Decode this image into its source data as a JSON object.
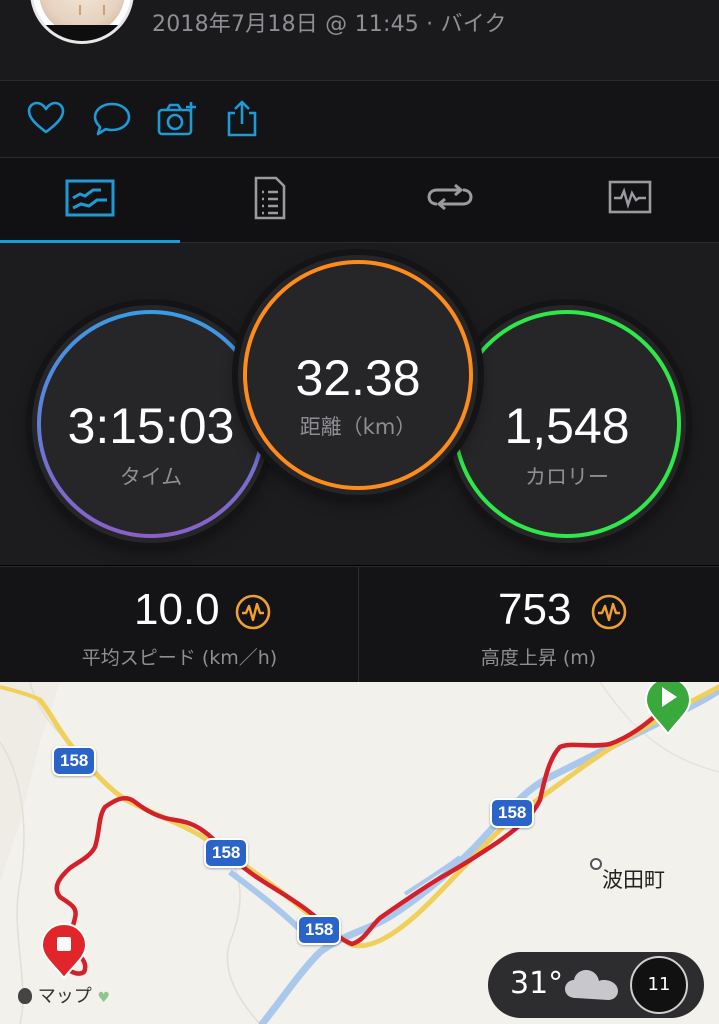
{
  "header": {
    "meta": "2018年7月18日 @ 11:45 · バイク"
  },
  "actions": {
    "like_icon": "heart-icon",
    "comment_icon": "comment-icon",
    "photo_icon": "add-photo-icon",
    "share_icon": "share-icon"
  },
  "tabs": [
    {
      "icon": "overview-icon",
      "active": true
    },
    {
      "icon": "details-icon",
      "active": false
    },
    {
      "icon": "laps-icon",
      "active": false
    },
    {
      "icon": "charts-icon",
      "active": false
    }
  ],
  "stats": {
    "time": {
      "value": "3:15:03",
      "label": "タイム"
    },
    "distance": {
      "value": "32.38",
      "label": "距離（km）"
    },
    "calories": {
      "value": "1,548",
      "label": "カロリー"
    }
  },
  "secondary": {
    "avg_speed": {
      "value": "10.0",
      "label": "平均スピード (km／h)"
    },
    "elevation": {
      "value": "753",
      "label": "高度上昇 (m)"
    }
  },
  "map": {
    "route_shields": [
      "158",
      "158",
      "158",
      "158"
    ],
    "place": "波田町",
    "attribution": "マップ",
    "weather_temp": "31°",
    "aqi": "11"
  },
  "colors": {
    "accent": "#1e9bd7",
    "time_ring": "#4a8fe0",
    "distance_ring": "#ff8c1a",
    "calories_ring": "#2ee84a",
    "route": "#d3202a",
    "gauge": "#f0a030"
  }
}
